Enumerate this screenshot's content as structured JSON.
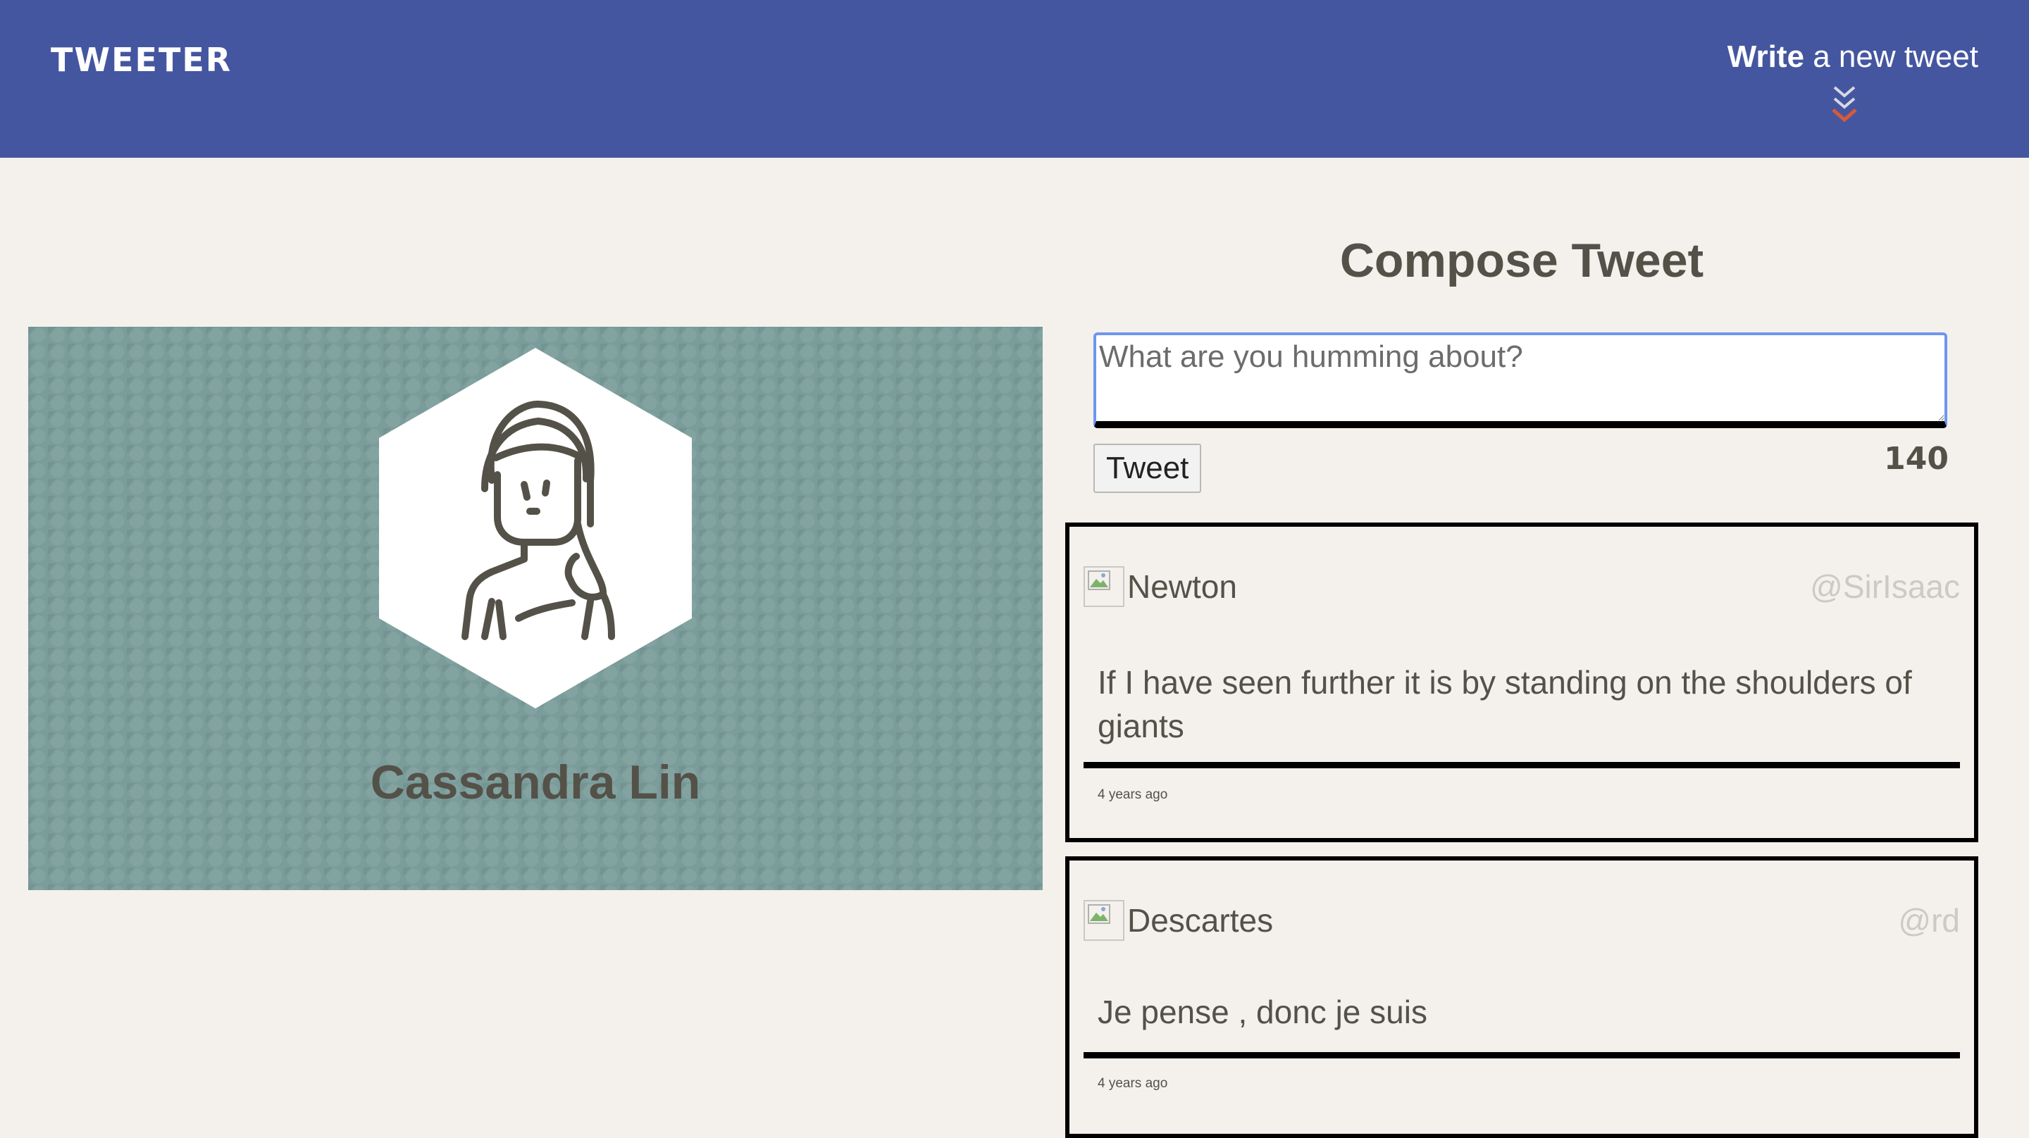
{
  "nav": {
    "brand": "TWEETER",
    "write_strong": "Write",
    "write_rest": " a new tweet",
    "chevron_colors": [
      "#d7d7e6",
      "#d85a36"
    ]
  },
  "profile": {
    "name": "Cassandra Lin",
    "background_color": "#7a9c9a"
  },
  "compose": {
    "title": "Compose Tweet",
    "placeholder": "What are you humming about?",
    "button_label": "Tweet",
    "counter": "140"
  },
  "tweets": [
    {
      "user": "Newton",
      "handle": "@SirIsaac",
      "content": "If I have seen further it is by standing on the shoulders of giants",
      "time": "4 years ago"
    },
    {
      "user": "Descartes",
      "handle": "@rd",
      "content": "Je pense , donc je suis",
      "time": "4 years ago"
    }
  ]
}
